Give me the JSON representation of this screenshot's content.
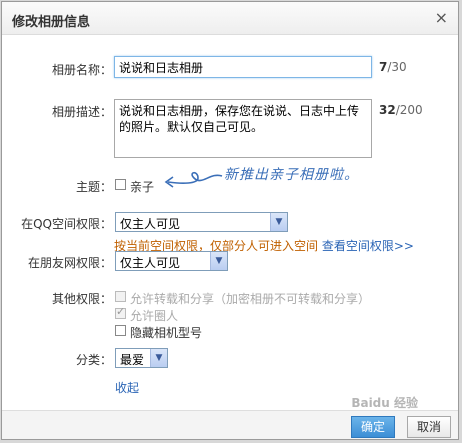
{
  "dialog": {
    "title": "修改相册信息",
    "close_glyph": "×"
  },
  "form": {
    "name_label": "相册名称：",
    "name_value": "说说和日志相册",
    "name_count_current": "7",
    "name_count_max": "/30",
    "desc_label": "相册描述：",
    "desc_value": "说说和日志相册，保存您在说说、日志中上传的照片。默认仅自己可见。",
    "desc_count_current": "32",
    "desc_count_max": "/200",
    "theme_label": "主题：",
    "theme_option": "亲子",
    "annotation_text": "新推出亲子相册啦。",
    "qzone_label": "在QQ空间权限：",
    "qzone_value": "仅主人可见",
    "qzone_hint": "按当前空间权限，仅部分人可进入空间 ",
    "qzone_hint_link": "查看空间权限>>",
    "friends_label": "在朋友网权限：",
    "friends_value": "仅主人可见",
    "other_label": "其他权限：",
    "other_options": [
      {
        "label": "允许转载和分享（加密相册不可转载和分享）",
        "checked": false,
        "disabled": true
      },
      {
        "label": "允许圈人",
        "checked": true,
        "disabled": true
      },
      {
        "label": "隐藏相机型号",
        "checked": false,
        "disabled": false
      }
    ],
    "category_label": "分类：",
    "category_value": "最爱",
    "collapse_link": "收起"
  },
  "footer": {
    "ok_label": "确定",
    "cancel_label": "取消"
  },
  "watermark": "Baidu 经验"
}
